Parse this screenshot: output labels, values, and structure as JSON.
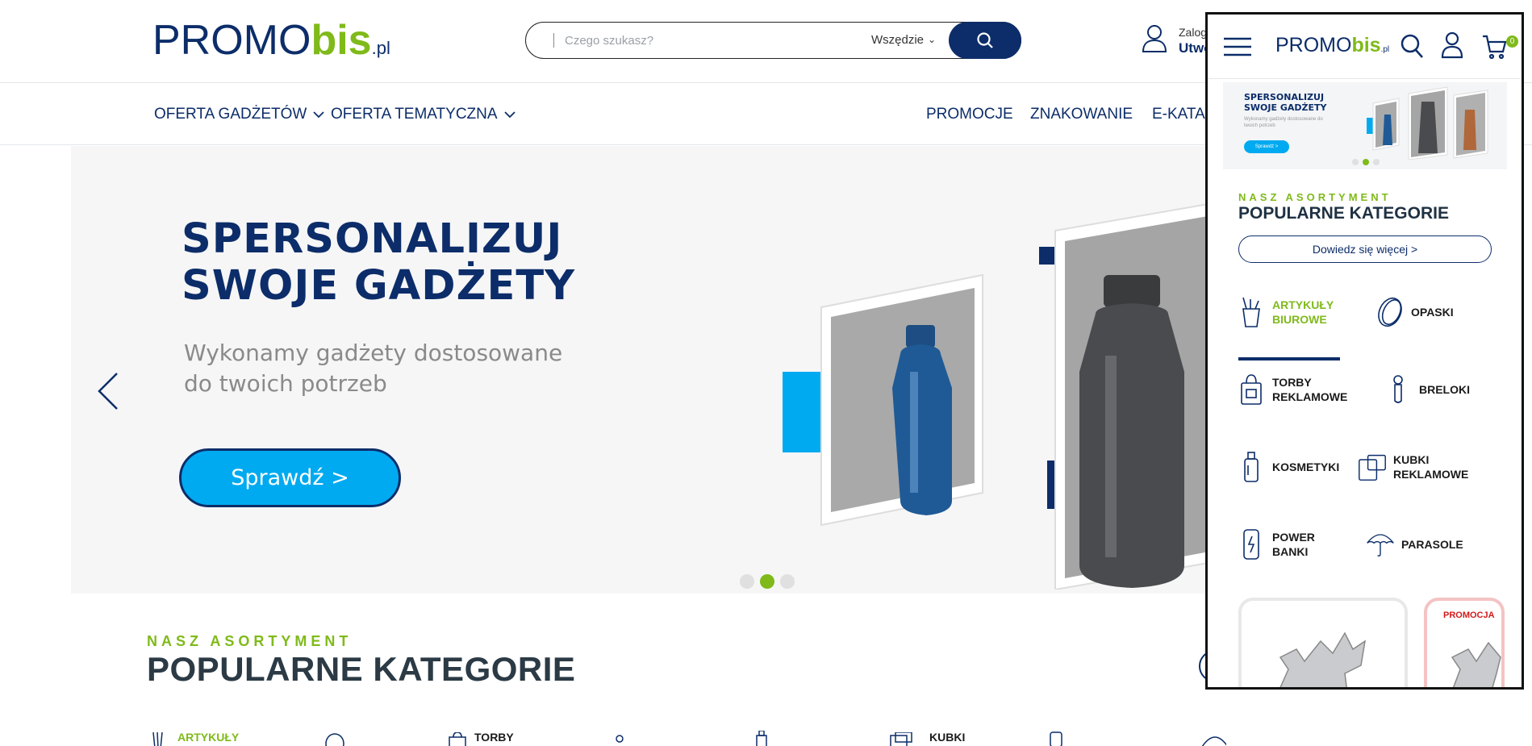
{
  "header": {
    "logo": {
      "part1": "PROMO",
      "part2": "bis",
      "part3": ".pl"
    },
    "search": {
      "placeholder": "Czego szukasz?",
      "scope": "Wszędzie"
    },
    "account": {
      "line1": "Zaloguj",
      "line2": "Utwórz"
    }
  },
  "nav": {
    "items": [
      {
        "label": "OFERTA GADŻETÓW"
      },
      {
        "label": "OFERTA TEMATYCZNA"
      },
      {
        "label": "PROMOCJE"
      },
      {
        "label": "ZNAKOWANIE"
      },
      {
        "label": "E-KATALOG"
      }
    ]
  },
  "hero": {
    "title_line1": "SPERSONALIZUJ",
    "title_line2": "SWOJE GADŻETY",
    "subtitle_line1": "Wykonamy gadżety dostosowane",
    "subtitle_line2": "do twoich potrzeb",
    "button": "Sprawdź >",
    "active_slide": 2,
    "slide_count": 3
  },
  "categories_section": {
    "kicker": "NASZ ASORTYMENT",
    "title": "POPULARNE KATEGORIE",
    "partial_labels": [
      "ARTYKUŁY",
      "TORBY",
      "KUBKI"
    ]
  },
  "mobile": {
    "logo": {
      "part1": "PROMO",
      "part2": "bis",
      "part3": ".pl"
    },
    "cart_count": "0",
    "banner": {
      "title_line1": "SPERSONALIZUJ",
      "title_line2": "SWOJE GADŻETY",
      "subtitle": "Wykonamy gadżety dostosowane do twoich potrzeb",
      "button": "Sprawdź >"
    },
    "kicker": "NASZ ASORTYMENT",
    "title": "POPULARNE KATEGORIE",
    "more_button": "Dowiedz się więcej >",
    "categories": [
      {
        "line1": "ARTYKUŁY",
        "line2": "BIUROWE",
        "icon": "pencil-cup-icon",
        "active": true
      },
      {
        "line1": "OPASKI",
        "line2": "",
        "icon": "wristband-icon",
        "active": false
      },
      {
        "line1": "TORBY",
        "line2": "REKLAMOWE",
        "icon": "bag-icon",
        "active": false
      },
      {
        "line1": "BRELOKI",
        "line2": "",
        "icon": "keychain-icon",
        "active": false
      },
      {
        "line1": "KOSMETYKI",
        "line2": "",
        "icon": "cosmetics-bottle-icon",
        "active": false
      },
      {
        "line1": "KUBKI",
        "line2": "REKLAMOWE",
        "icon": "mug-icon",
        "active": false
      },
      {
        "line1": "POWER",
        "line2": "BANKI",
        "icon": "powerbank-icon",
        "active": false
      },
      {
        "line1": "PARASOLE",
        "line2": "",
        "icon": "umbrella-icon",
        "active": false
      }
    ],
    "promo_tag": "PROMOCJA"
  },
  "colors": {
    "brand_navy": "#0c2d69",
    "brand_green": "#7fba1a",
    "accent_blue": "#00aaf0"
  }
}
